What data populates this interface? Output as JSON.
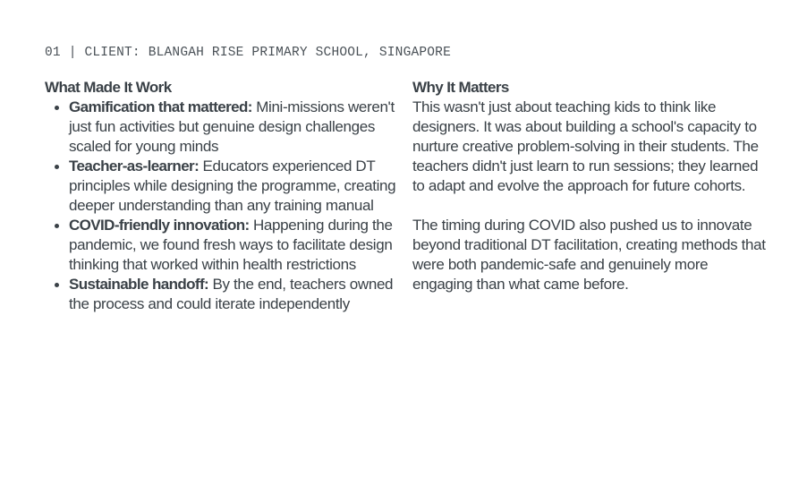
{
  "header": {
    "kicker": "01 | CLIENT: BLANGAH RISE PRIMARY SCHOOL, SINGAPORE"
  },
  "left_column": {
    "heading": "What Made It Work",
    "items": [
      {
        "lead": "Gamification that mattered:",
        "text": " Mini-missions weren't just fun activities but genuine design challenges scaled for young minds"
      },
      {
        "lead": "Teacher-as-learner:",
        "text": " Educators experienced DT principles while designing the programme, creating deeper understanding than any training manual"
      },
      {
        "lead": "COVID-friendly innovation:",
        "text": " Happening during the pandemic, we found fresh ways to facilitate design thinking that worked within health restrictions"
      },
      {
        "lead": "Sustainable handoff:",
        "text": " By the end, teachers owned the process and could iterate independently"
      }
    ]
  },
  "right_column": {
    "heading": "Why It Matters",
    "paragraphs": [
      "This wasn't just about teaching kids to think like designers. It was about building a school's capacity to nurture creative problem-solving in their students. The teachers didn't just learn to run sessions; they learned to adapt and evolve the approach for future cohorts.",
      "The timing during COVID also pushed us to innovate beyond traditional DT facilitation, creating methods that were both pandemic-safe and genuinely more engaging than what came before."
    ]
  }
}
